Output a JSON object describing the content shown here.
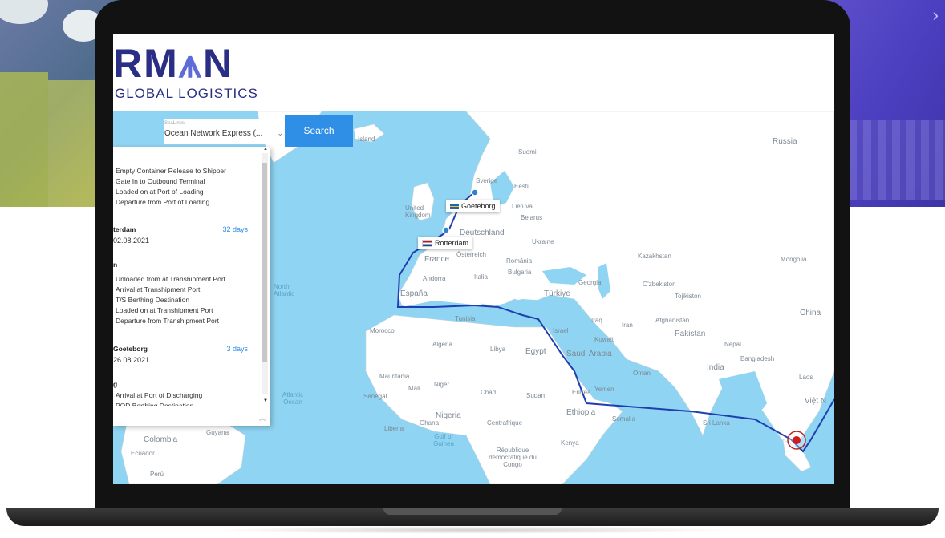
{
  "brand": {
    "logo_text_start": "RM",
    "logo_text_accent": "⩚",
    "logo_text_end": "N",
    "logo_subtitle": "GLOBAL LOGISTICS"
  },
  "search": {
    "sealine_label": "SeaLines",
    "sealine_value": "Ocean Network Express (...",
    "button_label": "Search"
  },
  "tracking": {
    "origin_events": [
      "Empty Container Release to Shipper",
      "Gate In to Outbound Terminal",
      "Loaded on at Port of Loading",
      "Departure from Port of Loading"
    ],
    "leg1": {
      "port": "terdam",
      "date": "02.08.2021",
      "days": "32 days"
    },
    "transhipment_label": "n",
    "transhipment_events": [
      "Unloaded from at Transhipment Port",
      "Arrival at Transhipment Port",
      "T/S Berthing Destination",
      "Loaded on at Transhipment Port",
      "Departure from Transhipment Port"
    ],
    "leg2": {
      "port": "Goeteborg",
      "date": "26.08.2021",
      "days": "3 days"
    },
    "destination_label": "g",
    "destination_events": [
      "Arrival at Port of Discharging",
      "POD Berthing Destination"
    ]
  },
  "ports": {
    "goeteborg": "Goeteborg",
    "rotterdam": "Rotterdam"
  },
  "map_labels": {
    "russia": "Russia",
    "island": "Island",
    "suomi": "Suomi",
    "sverige": "Sverige",
    "eesti": "Eesti",
    "lietuva": "Lietuva",
    "united_kingdom": "United Kingdom",
    "belarus": "Belarus",
    "deutschland": "Deutschland",
    "ukraine": "Ukraine",
    "france": "France",
    "osterreich": "Österreich",
    "romania": "România",
    "andorra": "Andorra",
    "italia": "Italia",
    "bulgaria": "Bulgaria",
    "espana": "España",
    "turkiye": "Türkiye",
    "georgia": "Georgia",
    "kazakhstan": "Kazakhstan",
    "mongolia": "Mongolia",
    "ozbekiston": "O'zbekiston",
    "tojikiston": "Tojikiston",
    "china": "China",
    "afghanistan": "Afghanistan",
    "iran": "Iran",
    "iraq": "Iraq",
    "pakistan": "Pakistan",
    "nepal": "Nepal",
    "bangladesh": "Bangladesh",
    "india": "India",
    "laos": "Laos",
    "viet_nam": "Việt N",
    "tunisia": "Tunisia",
    "morocco": "Morocco",
    "algeria": "Algeria",
    "libya": "Libya",
    "egypt": "Egypt",
    "saudi_arabia": "Saudi Arabia",
    "kuwait": "Kuwait",
    "oman": "Oman",
    "yemen": "Yemen",
    "israel": "Israel",
    "mauritania": "Mauritania",
    "mali": "Mali",
    "niger": "Niger",
    "chad": "Chad",
    "sudan": "Sudan",
    "eritrea": "Eritrea",
    "senegal": "Sénégal",
    "nigeria": "Nigeria",
    "ethiopia": "Ethiopia",
    "somalia": "Somalia",
    "ghana": "Ghana",
    "centrafrique": "Centrafrique",
    "liberia": "Liberia",
    "gulf_of_guinea": "Gulf of Guinea",
    "kenya": "Kenya",
    "rdc": "République démocratique du Congo",
    "sri_lanka": "Sri Lanka",
    "colombia": "Colombia",
    "guyana": "Guyana",
    "ecuador": "Ecuador",
    "peru": "Perú",
    "north_atlantic": "North Atlantic",
    "atlantic_ocean": "Atlantic Ocean"
  }
}
